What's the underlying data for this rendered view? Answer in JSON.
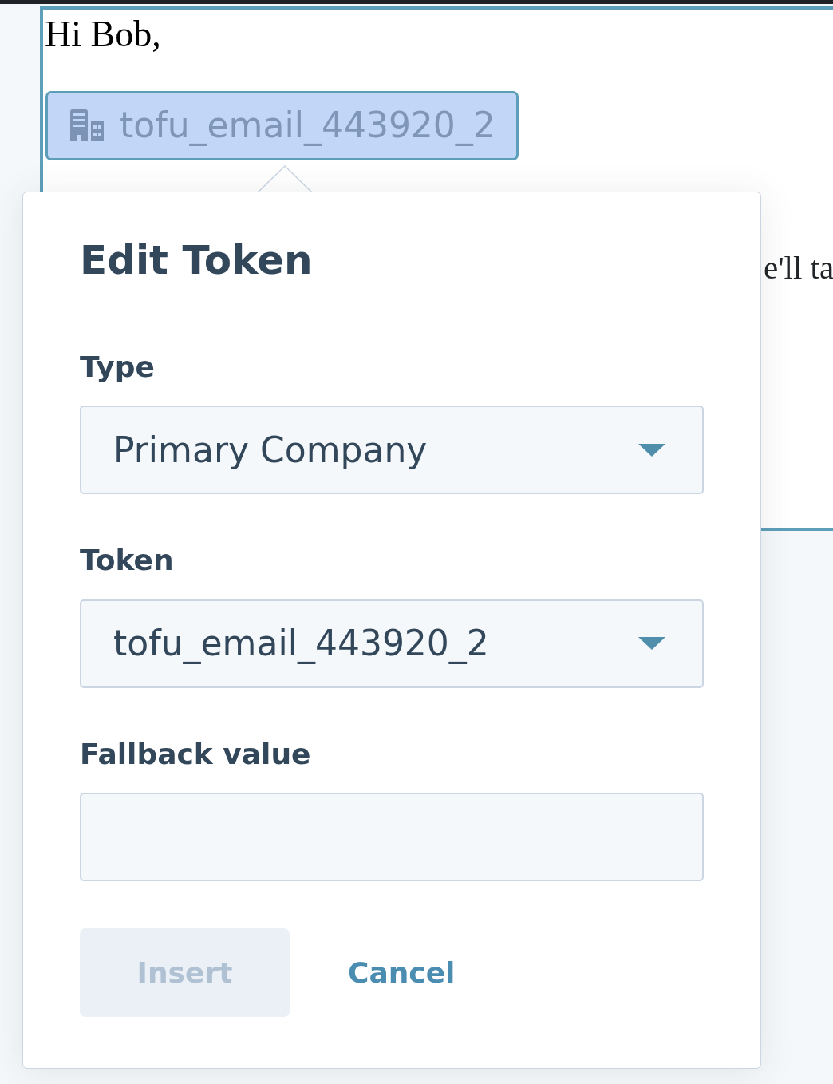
{
  "editor": {
    "greeting": "Hi Bob,",
    "token_chip": {
      "label": "tofu_email_443920_2",
      "selected": true
    },
    "partial_text": "e'll ta"
  },
  "popover": {
    "title": "Edit Token",
    "fields": [
      {
        "kind": "select",
        "label": "Type",
        "value": "Primary Company"
      },
      {
        "kind": "select",
        "label": "Token",
        "value": "tofu_email_443920_2"
      },
      {
        "kind": "text",
        "label": "Fallback value"
      }
    ],
    "buttons": [
      {
        "kind": "primary",
        "label": "Insert",
        "disabled": true
      },
      {
        "kind": "link",
        "label": "Cancel"
      }
    ]
  }
}
